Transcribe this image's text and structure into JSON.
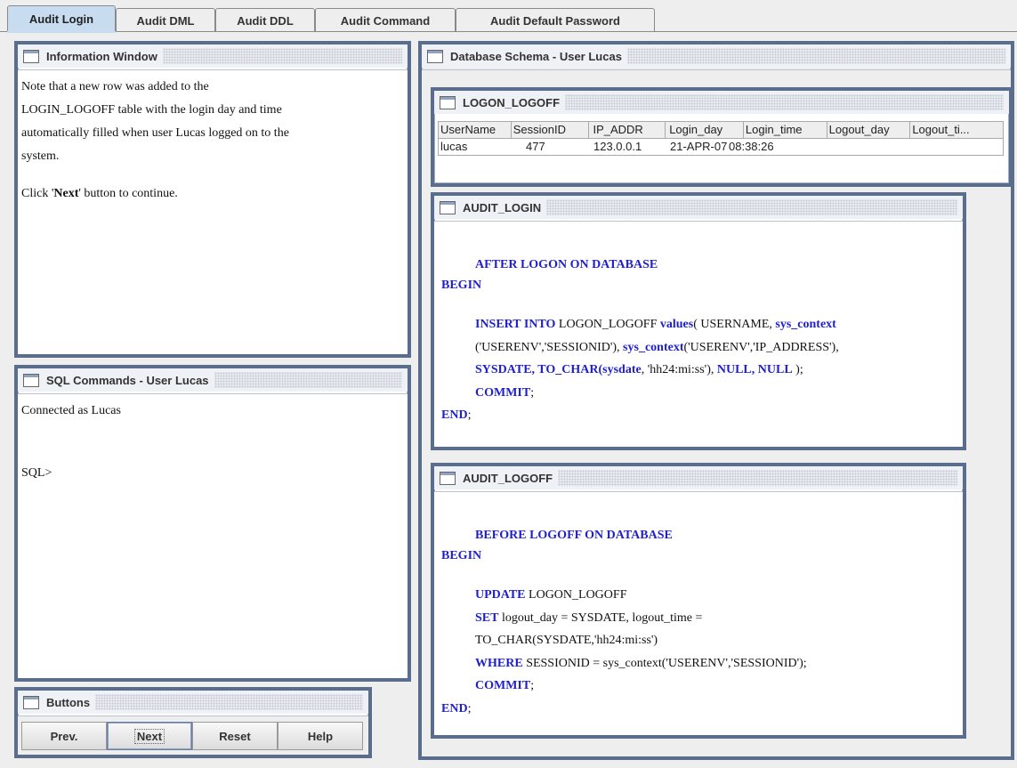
{
  "tabs": [
    "Audit Login",
    "Audit DML",
    "Audit DDL",
    "Audit Command",
    "Audit Default Password"
  ],
  "info_window": {
    "title": "Information Window",
    "lines": [
      "Note that a new row was added to the",
      "LOGIN_LOGOFF table with the login day and time",
      "automatically filled when user Lucas logged on to the",
      "system.",
      "Click ",
      "Next",
      " button to continue."
    ]
  },
  "sql_window": {
    "title": "SQL Commands - User Lucas",
    "line1": "Connected as Lucas",
    "prompt": "SQL>"
  },
  "buttons_window": {
    "title": "Buttons",
    "prev": "Prev.",
    "next": "Next",
    "reset": "Reset",
    "help": "Help"
  },
  "schema_window": {
    "title": "Database Schema - User Lucas"
  },
  "logon_table": {
    "title": "LOGON_LOGOFF",
    "columns": [
      "UserName",
      "SessionID",
      "IP_ADDR",
      "Login_day",
      "Login_time",
      "Logout_day",
      "Logout_ti..."
    ],
    "row": [
      "lucas",
      "477",
      "123.0.0.1",
      "21-APR-07",
      "08:38:26",
      "",
      ""
    ]
  },
  "audit_login": {
    "title": "AUDIT_LOGIN",
    "l1": "AFTER LOGON ON DATABASE",
    "l2": "BEGIN",
    "l3a": "INSERT INTO",
    "l3b": " LOGON_LOGOFF ",
    "l3c": "values",
    "l3d": "( USERNAME, ",
    "l3e": "sys_context",
    "l4a": "('USERENV','SESSIONID'), ",
    "l4b": "sys_context",
    "l4c": "('USERENV','IP_ADDRESS'),",
    "l5a": "SYSDATE, TO_CHAR(sysdate",
    "l5b": ", 'hh24:mi:ss'), ",
    "l5c": "NULL, NULL",
    "l5d": " );",
    "l6a": "COMMIT",
    "l6b": ";",
    "l7a": "END",
    "l7b": ";"
  },
  "audit_logoff": {
    "title": "AUDIT_LOGOFF",
    "l1": "BEFORE LOGOFF ON DATABASE",
    "l2": "BEGIN",
    "l3a": "UPDATE",
    "l3b": " LOGON_LOGOFF",
    "l4a": "SET",
    "l4b": " logout_day = SYSDATE, logout_time =",
    "l5": "TO_CHAR(SYSDATE,'hh24:mi:ss')",
    "l6a": "WHERE",
    "l6b": " SESSIONID = sys_context('USERENV','SESSIONID');",
    "l7a": "COMMIT",
    "l7b": ";",
    "l8a": "END",
    "l8b": ";"
  }
}
